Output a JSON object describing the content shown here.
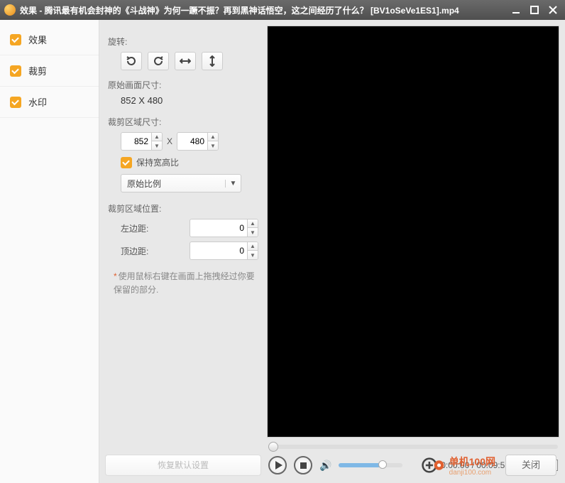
{
  "title": "效果 - 腾讯最有机会封神的《斗战神》为何一蹶不振？再到黑神话悟空，这之间经历了什么？ [BV1oSeVe1ES1].mp4",
  "sidebar": {
    "items": [
      {
        "label": "效果"
      },
      {
        "label": "裁剪"
      },
      {
        "label": "水印"
      }
    ]
  },
  "settings": {
    "rotate_label": "旋转:",
    "orig_size_label": "原始画面尺寸:",
    "orig_size_value": "852 X 480",
    "crop_size_label": "裁剪区域尺寸:",
    "crop_w": "852",
    "crop_h": "480",
    "x_sep": "X",
    "keep_ratio_label": "保持宽高比",
    "ratio_combo": "原始比例",
    "crop_pos_label": "裁剪区域位置:",
    "left_label": "左边距:",
    "left_val": "0",
    "top_label": "顶边距:",
    "top_val": "0",
    "hint": "使用鼠标右键在画面上拖拽经过你要保留的部分."
  },
  "player": {
    "current": "00:00:00",
    "sep": " / ",
    "total": "00:09:52"
  },
  "bottom": {
    "reset": "恢复默认设置",
    "brand_cn": "单机100网",
    "brand_en": "danji100.com",
    "close": "关闭"
  }
}
